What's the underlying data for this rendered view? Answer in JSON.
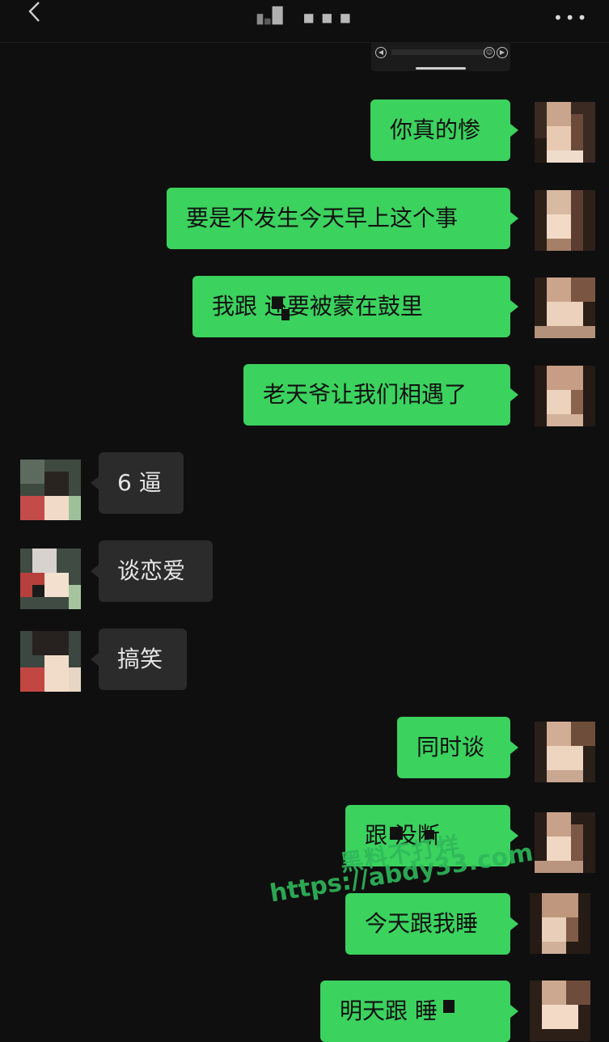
{
  "header": {
    "back_icon": "chevron-left-icon",
    "more_label": "•••"
  },
  "floating_player": {
    "left_icon": "rewind-icon",
    "emoji_icon": "emoji-icon",
    "right_icon": "forward-icon"
  },
  "messages": [
    {
      "side": "me",
      "text": "你真的惨"
    },
    {
      "side": "me",
      "text": "要是不发生今天早上这个事"
    },
    {
      "side": "me",
      "text": "我跟    还要被蒙在鼓里"
    },
    {
      "side": "me",
      "text": "老天爷让我们相遇了"
    },
    {
      "side": "other",
      "text": "6 逼"
    },
    {
      "side": "other",
      "text": "谈恋爱"
    },
    {
      "side": "other",
      "text": "搞笑"
    },
    {
      "side": "me",
      "text": "同时谈"
    },
    {
      "side": "me",
      "text": "跟     没断"
    },
    {
      "side": "me",
      "text": "今天跟我睡"
    },
    {
      "side": "me",
      "text": "明天跟    睡"
    }
  ],
  "watermark": {
    "line1": "黑料不打烊",
    "line2": "https://abdy33.com"
  },
  "colors": {
    "background": "#0f0f0f",
    "my_bubble": "#3bd25e",
    "other_bubble": "#2b2b2b",
    "watermark": "#2fb85a"
  }
}
